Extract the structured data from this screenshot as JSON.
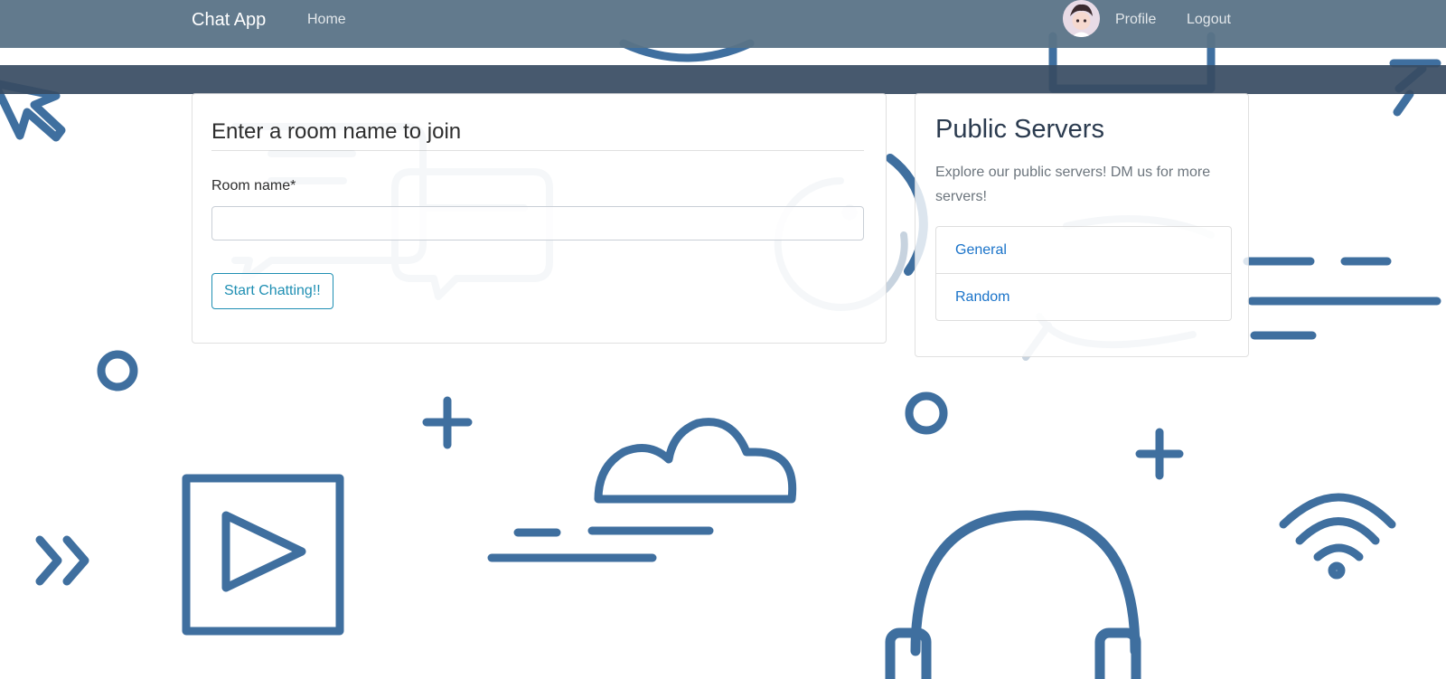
{
  "navbar": {
    "brand": "Chat App",
    "home": "Home",
    "profile": "Profile",
    "logout": "Logout",
    "background_color": "#5a7387"
  },
  "join": {
    "title": "Enter a room name to join",
    "room_label": "Room name*",
    "room_value": "",
    "button_label": "Start Chatting!!"
  },
  "servers": {
    "title": "Public Servers",
    "description": "Explore our public servers! DM us for more servers!",
    "items": [
      {
        "label": "General"
      },
      {
        "label": "Random"
      }
    ]
  },
  "colors": {
    "doodle": "#3f6f9f",
    "link": "#1a73c9",
    "button_outline": "#1f8fb3",
    "banner": "#374b62"
  },
  "icons": [
    "cursor-arrow-icon",
    "chat-bubble-icon",
    "smiley-icon",
    "circle-icon",
    "plus-icon",
    "cloud-icon",
    "play-square-icon",
    "fast-forward-icon",
    "headphones-icon",
    "wifi-icon",
    "speed-lines-icon"
  ]
}
